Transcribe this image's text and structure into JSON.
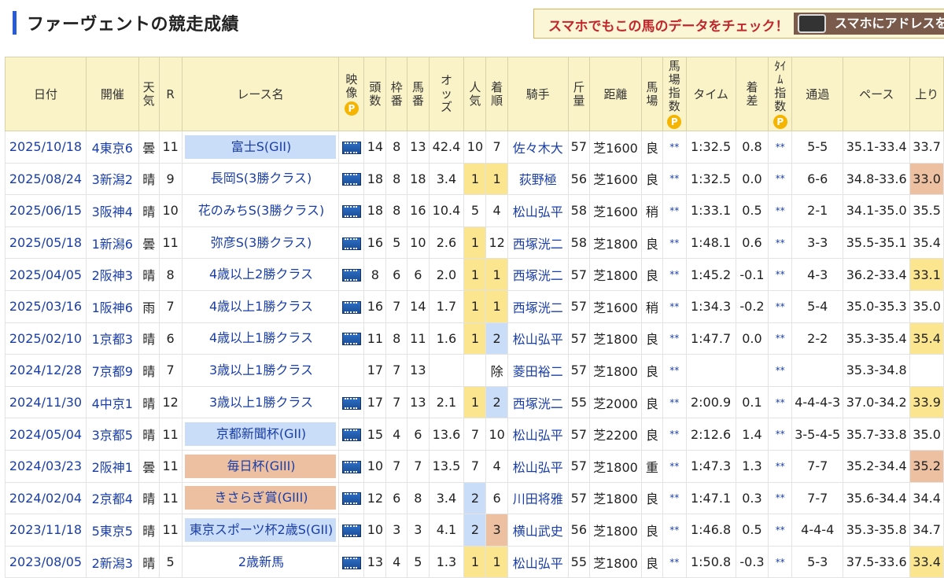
{
  "page": {
    "title": "ファーヴェントの競走成績",
    "promo_text": "スマホでもこの馬のデータをチェック！",
    "promo_button": "スマホにアドレスを送"
  },
  "table": {
    "headers": {
      "date": "日付",
      "venue": "開催",
      "weather": "天気",
      "race_no": "R",
      "race_name": "レース名",
      "video": "映像",
      "runners": "頭数",
      "gate": "枠番",
      "horse_no": "馬番",
      "odds": "オッズ",
      "popularity": "人気",
      "finish": "着順",
      "jockey": "騎手",
      "weight": "斤量",
      "distance": "距離",
      "track": "馬場",
      "track_index": "馬場指数",
      "time": "タイム",
      "margin": "着差",
      "time_index": "ﾀｲﾑ指数",
      "passing": "通過",
      "pace": "ペース",
      "last3f": "上り",
      "p_badge": "P"
    },
    "rows": [
      {
        "date": "2025/10/18",
        "venue": "4東京6",
        "weather": "曇",
        "race_no": "11",
        "race_name": "富士S(GII)",
        "grade": "g2",
        "video": "video-icon",
        "runners": "14",
        "gate": "8",
        "horse_no": "13",
        "odds": "42.4",
        "popularity": "10",
        "finish": "7",
        "jockey": "佐々木大",
        "weight": "57",
        "distance": "芝1600",
        "track": "良",
        "track_index": "**",
        "time": "1:32.5",
        "margin": "0.8",
        "time_index": "**",
        "passing": "5-5",
        "pace": "35.1-33.4",
        "last3f": "33.7",
        "pop_rank": 0,
        "finish_rank": 0,
        "last3f_rank": 0
      },
      {
        "date": "2025/08/24",
        "venue": "3新潟2",
        "weather": "晴",
        "race_no": "9",
        "race_name": "長岡S(3勝クラス)",
        "grade": "",
        "video": "video-icon",
        "runners": "18",
        "gate": "8",
        "horse_no": "18",
        "odds": "3.4",
        "popularity": "1",
        "finish": "1",
        "jockey": "荻野極",
        "weight": "56",
        "distance": "芝1600",
        "track": "良",
        "track_index": "**",
        "time": "1:32.5",
        "margin": "0.0",
        "time_index": "**",
        "passing": "6-6",
        "pace": "34.8-33.6",
        "last3f": "33.0",
        "pop_rank": 1,
        "finish_rank": 1,
        "last3f_rank": 3
      },
      {
        "date": "2025/06/15",
        "venue": "3阪神4",
        "weather": "晴",
        "race_no": "10",
        "race_name": "花のみちS(3勝クラス)",
        "grade": "",
        "video": "video-icon",
        "runners": "18",
        "gate": "8",
        "horse_no": "16",
        "odds": "10.4",
        "popularity": "5",
        "finish": "4",
        "jockey": "松山弘平",
        "weight": "58",
        "distance": "芝1600",
        "track": "稍",
        "track_index": "**",
        "time": "1:33.1",
        "margin": "0.5",
        "time_index": "**",
        "passing": "2-1",
        "pace": "34.1-35.0",
        "last3f": "35.5",
        "pop_rank": 0,
        "finish_rank": 0,
        "last3f_rank": 0
      },
      {
        "date": "2025/05/18",
        "venue": "1新潟6",
        "weather": "曇",
        "race_no": "11",
        "race_name": "弥彦S(3勝クラス)",
        "grade": "",
        "video": "video-icon",
        "runners": "16",
        "gate": "5",
        "horse_no": "10",
        "odds": "2.6",
        "popularity": "1",
        "finish": "12",
        "jockey": "西塚洸二",
        "weight": "58",
        "distance": "芝1800",
        "track": "良",
        "track_index": "**",
        "time": "1:48.1",
        "margin": "0.6",
        "time_index": "**",
        "passing": "3-3",
        "pace": "35.5-35.1",
        "last3f": "35.4",
        "pop_rank": 1,
        "finish_rank": 0,
        "last3f_rank": 0
      },
      {
        "date": "2025/04/05",
        "venue": "2阪神3",
        "weather": "晴",
        "race_no": "8",
        "race_name": "4歳以上2勝クラス",
        "grade": "",
        "video": "video-icon",
        "runners": "8",
        "gate": "6",
        "horse_no": "6",
        "odds": "2.0",
        "popularity": "1",
        "finish": "1",
        "jockey": "西塚洸二",
        "weight": "57",
        "distance": "芝1800",
        "track": "良",
        "track_index": "**",
        "time": "1:45.2",
        "margin": "-0.1",
        "time_index": "**",
        "passing": "4-3",
        "pace": "36.2-33.4",
        "last3f": "33.1",
        "pop_rank": 1,
        "finish_rank": 1,
        "last3f_rank": 1
      },
      {
        "date": "2025/03/16",
        "venue": "1阪神6",
        "weather": "雨",
        "race_no": "7",
        "race_name": "4歳以上1勝クラス",
        "grade": "",
        "video": "video-icon",
        "runners": "16",
        "gate": "7",
        "horse_no": "14",
        "odds": "1.7",
        "popularity": "1",
        "finish": "1",
        "jockey": "西塚洸二",
        "weight": "57",
        "distance": "芝1600",
        "track": "稍",
        "track_index": "**",
        "time": "1:34.3",
        "margin": "-0.2",
        "time_index": "**",
        "passing": "5-4",
        "pace": "35.0-35.3",
        "last3f": "35.0",
        "pop_rank": 1,
        "finish_rank": 1,
        "last3f_rank": 0
      },
      {
        "date": "2025/02/10",
        "venue": "1京都3",
        "weather": "晴",
        "race_no": "6",
        "race_name": "4歳以上1勝クラス",
        "grade": "",
        "video": "video-icon",
        "runners": "11",
        "gate": "8",
        "horse_no": "11",
        "odds": "1.6",
        "popularity": "1",
        "finish": "2",
        "jockey": "松山弘平",
        "weight": "57",
        "distance": "芝1800",
        "track": "良",
        "track_index": "**",
        "time": "1:47.7",
        "margin": "0.0",
        "time_index": "**",
        "passing": "2-2",
        "pace": "35.3-35.4",
        "last3f": "35.4",
        "pop_rank": 1,
        "finish_rank": 2,
        "last3f_rank": 1
      },
      {
        "date": "2024/12/28",
        "venue": "7京都9",
        "weather": "晴",
        "race_no": "7",
        "race_name": "3歳以上1勝クラス",
        "grade": "",
        "video": "",
        "runners": "17",
        "gate": "7",
        "horse_no": "13",
        "odds": "",
        "popularity": "",
        "finish": "除",
        "jockey": "菱田裕二",
        "weight": "57",
        "distance": "芝1800",
        "track": "良",
        "track_index": "**",
        "time": "",
        "margin": "",
        "time_index": "**",
        "passing": "",
        "pace": "35.3-34.8",
        "last3f": "",
        "pop_rank": 0,
        "finish_rank": 0,
        "last3f_rank": 0
      },
      {
        "date": "2024/11/30",
        "venue": "4中京1",
        "weather": "晴",
        "race_no": "12",
        "race_name": "3歳以上1勝クラス",
        "grade": "",
        "video": "video-icon",
        "runners": "17",
        "gate": "7",
        "horse_no": "13",
        "odds": "2.1",
        "popularity": "1",
        "finish": "2",
        "jockey": "西塚洸二",
        "weight": "55",
        "distance": "芝2000",
        "track": "良",
        "track_index": "**",
        "time": "2:00.9",
        "margin": "0.1",
        "time_index": "**",
        "passing": "4-4-4-3",
        "pace": "37.0-34.2",
        "last3f": "33.9",
        "pop_rank": 1,
        "finish_rank": 2,
        "last3f_rank": 1
      },
      {
        "date": "2024/05/04",
        "venue": "3京都5",
        "weather": "晴",
        "race_no": "11",
        "race_name": "京都新聞杯(GII)",
        "grade": "g2",
        "video": "video-icon",
        "runners": "15",
        "gate": "4",
        "horse_no": "6",
        "odds": "13.6",
        "popularity": "7",
        "finish": "10",
        "jockey": "松山弘平",
        "weight": "57",
        "distance": "芝2200",
        "track": "良",
        "track_index": "**",
        "time": "2:12.6",
        "margin": "1.4",
        "time_index": "**",
        "passing": "3-5-4-5",
        "pace": "35.7-33.8",
        "last3f": "35.0",
        "pop_rank": 0,
        "finish_rank": 0,
        "last3f_rank": 0
      },
      {
        "date": "2024/03/23",
        "venue": "2阪神1",
        "weather": "曇",
        "race_no": "11",
        "race_name": "毎日杯(GIII)",
        "grade": "g3",
        "video": "video-icon",
        "runners": "10",
        "gate": "7",
        "horse_no": "7",
        "odds": "13.5",
        "popularity": "7",
        "finish": "4",
        "jockey": "松山弘平",
        "weight": "57",
        "distance": "芝1800",
        "track": "重",
        "track_index": "**",
        "time": "1:47.3",
        "margin": "1.3",
        "time_index": "**",
        "passing": "7-7",
        "pace": "35.2-34.4",
        "last3f": "35.2",
        "pop_rank": 0,
        "finish_rank": 0,
        "last3f_rank": 3
      },
      {
        "date": "2024/02/04",
        "venue": "2京都4",
        "weather": "晴",
        "race_no": "11",
        "race_name": "きさらぎ賞(GIII)",
        "grade": "g3",
        "video": "video-icon",
        "runners": "12",
        "gate": "6",
        "horse_no": "8",
        "odds": "3.4",
        "popularity": "2",
        "finish": "6",
        "jockey": "川田将雅",
        "weight": "57",
        "distance": "芝1800",
        "track": "良",
        "track_index": "**",
        "time": "1:47.1",
        "margin": "0.3",
        "time_index": "**",
        "passing": "7-7",
        "pace": "35.6-34.4",
        "last3f": "34.4",
        "pop_rank": 2,
        "finish_rank": 0,
        "last3f_rank": 0
      },
      {
        "date": "2023/11/18",
        "venue": "5東京5",
        "weather": "晴",
        "race_no": "11",
        "race_name": "東京スポーツ杯2歳S(GII)",
        "grade": "g2",
        "video": "video-icon",
        "runners": "10",
        "gate": "3",
        "horse_no": "3",
        "odds": "4.1",
        "popularity": "2",
        "finish": "3",
        "jockey": "横山武史",
        "weight": "56",
        "distance": "芝1800",
        "track": "良",
        "track_index": "**",
        "time": "1:46.8",
        "margin": "0.5",
        "time_index": "**",
        "passing": "4-4-4",
        "pace": "35.3-35.8",
        "last3f": "34.7",
        "pop_rank": 2,
        "finish_rank": 3,
        "last3f_rank": 0
      },
      {
        "date": "2023/08/05",
        "venue": "2新潟3",
        "weather": "晴",
        "race_no": "5",
        "race_name": "2歳新馬",
        "grade": "",
        "video": "video-icon",
        "runners": "13",
        "gate": "4",
        "horse_no": "5",
        "odds": "1.3",
        "popularity": "1",
        "finish": "1",
        "jockey": "松山弘平",
        "weight": "55",
        "distance": "芝1800",
        "track": "良",
        "track_index": "**",
        "time": "1:50.8",
        "margin": "-0.3",
        "time_index": "**",
        "passing": "5-3",
        "pace": "37.5-33.6",
        "last3f": "33.4",
        "pop_rank": 1,
        "finish_rank": 1,
        "last3f_rank": 1
      }
    ]
  }
}
